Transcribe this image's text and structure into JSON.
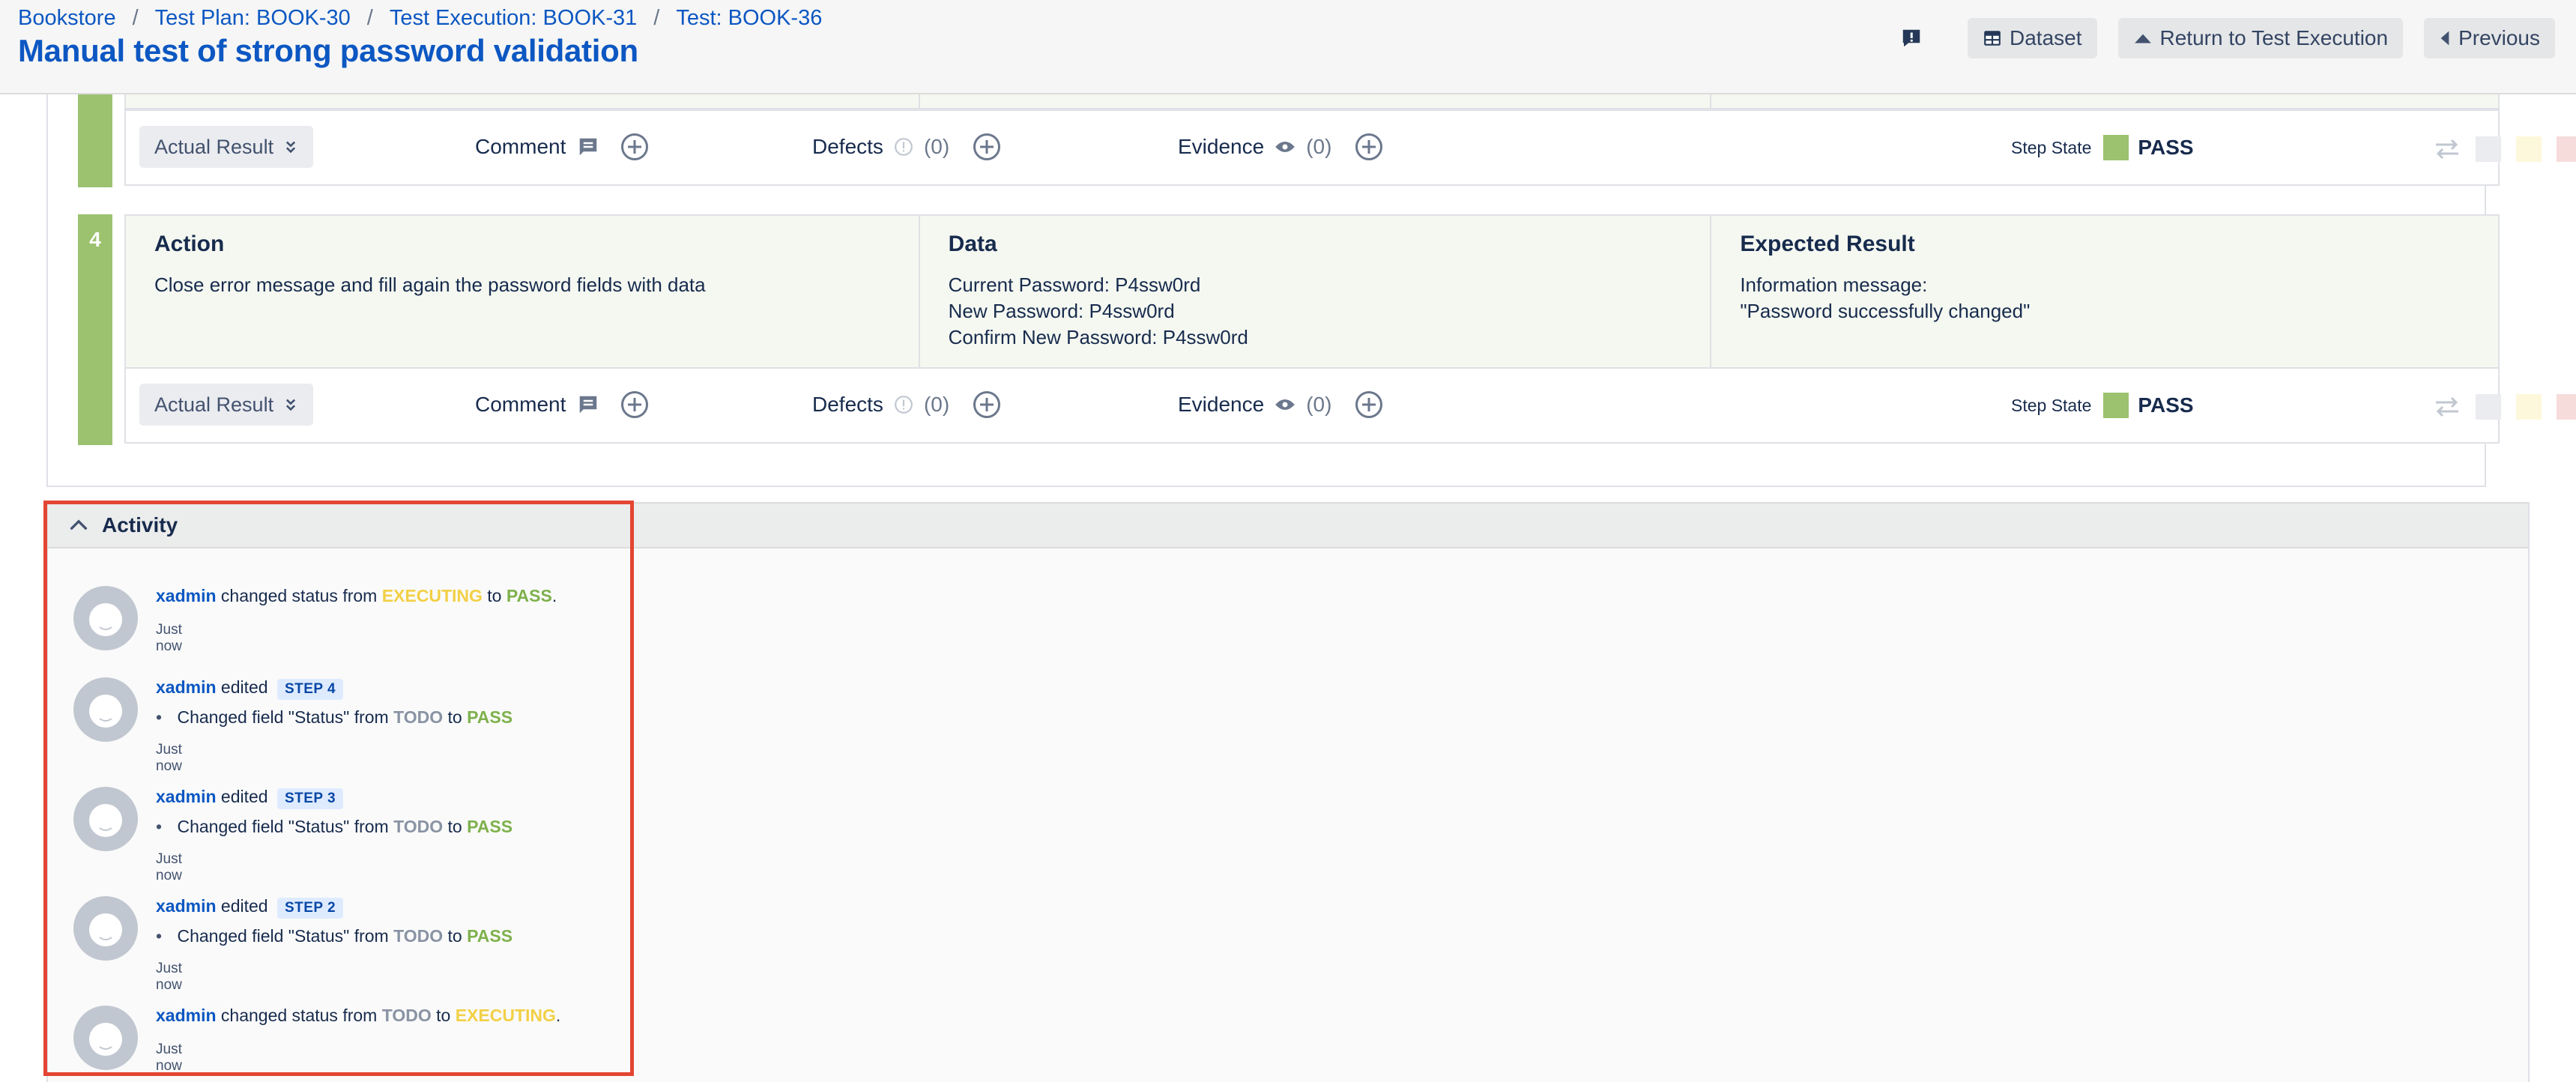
{
  "header": {
    "breadcrumbs": [
      "Bookstore",
      "Test Plan: BOOK-30",
      "Test Execution: BOOK-31",
      "Test: BOOK-36"
    ],
    "title": "Manual test of strong password validation",
    "buttons": {
      "dataset": "Dataset",
      "return": "Return to Test Execution",
      "previous": "Previous"
    }
  },
  "steps": {
    "columns": {
      "action": "Action",
      "data": "Data",
      "expected": "Expected Result"
    },
    "step4": {
      "number": "4",
      "action": "Close error message and fill again the password fields with data",
      "data": [
        "Current Password: P4ssw0rd",
        "New Password: P4ssw0rd",
        "Confirm New Password: P4ssw0rd"
      ],
      "expected": [
        "Information message:",
        "\"Password successfully changed\""
      ]
    },
    "actual_row": {
      "actual_result": "Actual Result",
      "comment": "Comment",
      "defects": "Defects",
      "defects_count": "(0)",
      "evidence": "Evidence",
      "evidence_count": "(0)",
      "step_state_label": "Step State",
      "step_state_value": "PASS"
    },
    "state_colors": {
      "pass": "#9cc26f",
      "swatches": [
        "#ebecf0",
        "#fdf8dc",
        "#f6dcdb",
        "#fbd6f7"
      ]
    }
  },
  "activity": {
    "title": "Activity",
    "entries": [
      {
        "user": "xadmin",
        "verb": "changed status from",
        "from": "EXECUTING",
        "to_word": "to",
        "to": "PASS",
        "end": ".",
        "time": "Just now"
      },
      {
        "user": "xadmin",
        "verb": "edited",
        "badge": "STEP 4",
        "change_prefix": "Changed field \"Status\" from",
        "from": "TODO",
        "to_word": "to",
        "to": "PASS",
        "time": "Just now"
      },
      {
        "user": "xadmin",
        "verb": "edited",
        "badge": "STEP 3",
        "change_prefix": "Changed field \"Status\" from",
        "from": "TODO",
        "to_word": "to",
        "to": "PASS",
        "time": "Just now"
      },
      {
        "user": "xadmin",
        "verb": "edited",
        "badge": "STEP 2",
        "change_prefix": "Changed field \"Status\" from",
        "from": "TODO",
        "to_word": "to",
        "to": "PASS",
        "time": "Just now"
      },
      {
        "user": "xadmin",
        "verb": "changed status from",
        "from": "TODO",
        "to_word": "to",
        "to": "EXECUTING",
        "end": ".",
        "time": "Just now"
      }
    ]
  },
  "colors": {
    "link": "#0c57c2",
    "executing": "#f2d046",
    "pass": "#7eb14c",
    "todo": "#8993a4",
    "highlight": "#e34532"
  }
}
